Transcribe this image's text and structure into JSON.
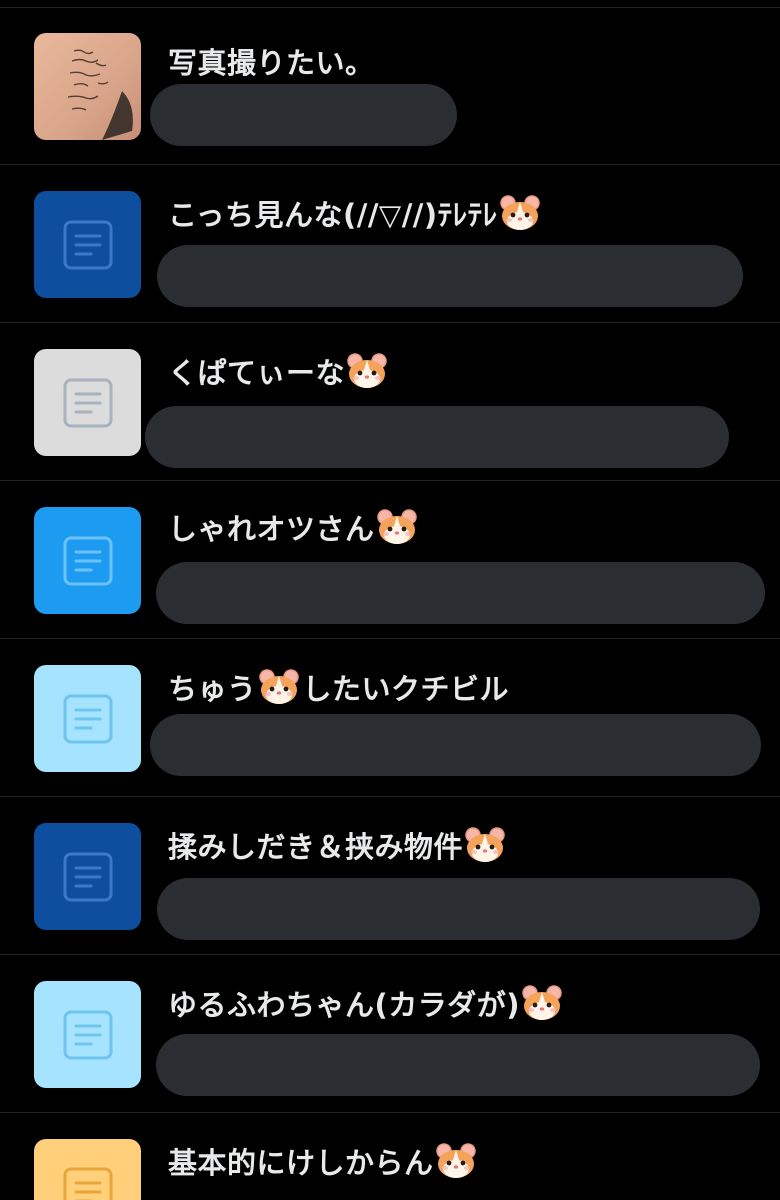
{
  "list": {
    "items": [
      {
        "title": "写真撮りたい。",
        "emoji": false,
        "thumb": "photo",
        "thumb_color": "#d9a58a"
      },
      {
        "title": "こっち見んな(//▽//)ﾃﾚﾃﾚ",
        "emoji": true,
        "thumb": "doc",
        "thumb_color": "#0d4e9e",
        "icon_color": "#3a78c9"
      },
      {
        "title": "くぱてぃーな",
        "emoji": true,
        "thumb": "doc",
        "thumb_color": "#dcdcdc",
        "icon_color": "#a9b2c0"
      },
      {
        "title": "しゃれオツさん",
        "emoji": true,
        "thumb": "doc",
        "thumb_color": "#1d9bf0",
        "icon_color": "#6cc1ff"
      },
      {
        "title": "ちゅう",
        "title_after": "したいクチビル",
        "emoji": true,
        "thumb": "doc",
        "thumb_color": "#a6e3ff",
        "icon_color": "#6ec4ee"
      },
      {
        "title": "揉みしだき＆挟み物件",
        "emoji": true,
        "thumb": "doc",
        "thumb_color": "#0d4e9e",
        "icon_color": "#3a78c9"
      },
      {
        "title": "ゆるふわちゃん(カラダが)",
        "emoji": true,
        "thumb": "doc",
        "thumb_color": "#a6e3ff",
        "icon_color": "#6ec4ee"
      },
      {
        "title": "基本的にけしからん",
        "emoji": true,
        "thumb": "doc",
        "thumb_color": "#ffcf7a",
        "icon_color": "#e7a53c"
      }
    ],
    "emoji_name": "hamster-face-icon",
    "doc_icon_name": "document-icon"
  }
}
